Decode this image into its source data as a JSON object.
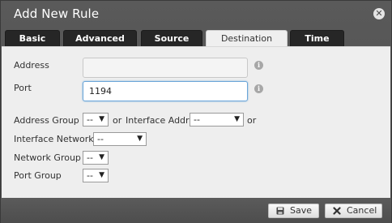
{
  "dialog": {
    "title": "Add New Rule",
    "close_glyph": "✕"
  },
  "tabs": [
    {
      "label": "Basic",
      "active": false
    },
    {
      "label": "Advanced",
      "active": false
    },
    {
      "label": "Source",
      "active": false
    },
    {
      "label": "Destination",
      "active": true
    },
    {
      "label": "Time",
      "active": false
    }
  ],
  "form": {
    "address": {
      "label": "Address",
      "value": "",
      "info_glyph": "i"
    },
    "port": {
      "label": "Port",
      "value": "1194",
      "info_glyph": "i"
    },
    "address_group": {
      "label": "Address Group",
      "selected": "--"
    },
    "or_1": "or",
    "interface_addr": {
      "label": "Interface Addr",
      "selected": "--"
    },
    "or_2": "or",
    "interface_network": {
      "label": "Interface Network",
      "selected": "--"
    },
    "network_group": {
      "label": "Network Group",
      "selected": "--"
    },
    "port_group": {
      "label": "Port Group",
      "selected": "--"
    }
  },
  "footer": {
    "save_label": "Save",
    "cancel_label": "Cancel",
    "save_icon": "floppy-disk-icon",
    "cancel_icon": "x-icon"
  },
  "colors": {
    "titlebar_bg": "#555555",
    "tab_bg": "#262626",
    "tab_active_bg": "#efefef",
    "panel_bg": "#eeeeee",
    "focus_border": "#6aa5d8"
  }
}
